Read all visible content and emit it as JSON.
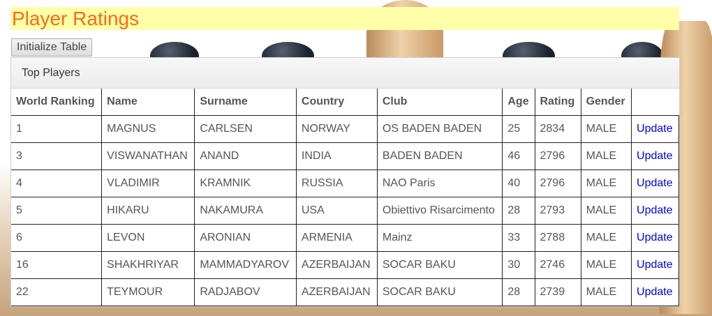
{
  "page": {
    "title": "Player Ratings"
  },
  "toolbar": {
    "init_label": "Initialize Table"
  },
  "panel": {
    "heading": "Top Players"
  },
  "table": {
    "headers": [
      "World Ranking",
      "Name",
      "Surname",
      "Country",
      "Club",
      "Age",
      "Rating",
      "Gender",
      ""
    ],
    "rows": [
      [
        "1",
        "MAGNUS",
        "CARLSEN",
        "NORWAY",
        "OS BADEN BADEN",
        "25",
        "2834",
        "MALE",
        "Update"
      ],
      [
        "3",
        "VISWANATHAN",
        "ANAND",
        "INDIA",
        "BADEN BADEN",
        "46",
        "2796",
        "MALE",
        "Update"
      ],
      [
        "4",
        "VLADIMIR",
        "KRAMNIK",
        "RUSSIA",
        "NAO Paris",
        "40",
        "2796",
        "MALE",
        "Update"
      ],
      [
        "5",
        "HIKARU",
        "NAKAMURA",
        "USA",
        "Obiettivo Risarcimento",
        "28",
        "2793",
        "MALE",
        "Update"
      ],
      [
        "6",
        "LEVON",
        "ARONIAN",
        "ARMENIA",
        "Mainz",
        "33",
        "2788",
        "MALE",
        "Update"
      ],
      [
        "16",
        "SHAKHRIYAR",
        "MAMMADYAROV",
        "AZERBAIJAN",
        "SOCAR BAKU",
        "30",
        "2746",
        "MALE",
        "Update"
      ],
      [
        "22",
        "TEYMOUR",
        "RADJABOV",
        "AZERBAIJAN",
        "SOCAR BAKU",
        "28",
        "2739",
        "MALE",
        "Update"
      ]
    ]
  }
}
